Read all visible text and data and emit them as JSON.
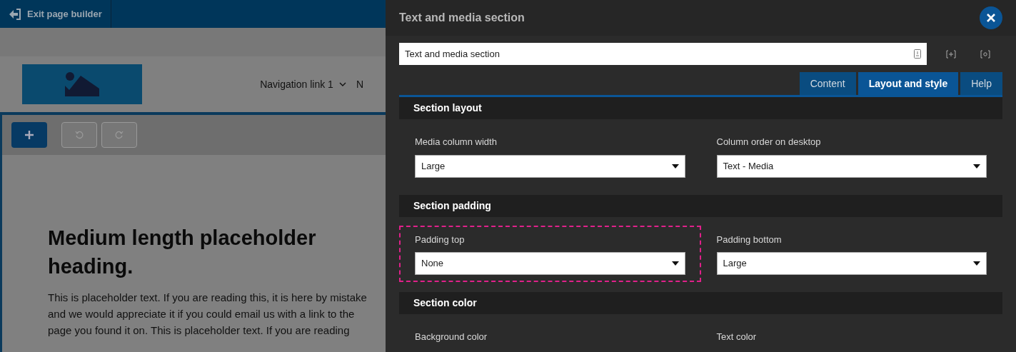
{
  "top_bar": {
    "exit_button": "Exit page builder"
  },
  "site_header": {
    "nav_link": "Navigation link 1",
    "nav_link_cut": "N"
  },
  "content": {
    "heading": "Medium length placeholder heading.",
    "paragraph": "This is placeholder text. If you are reading this, it is here by mistake and we would appreciate it if you could email us with a link to the page you found it on. This is placeholder text. If you are reading"
  },
  "panel": {
    "title": "Text and media section",
    "name_field": {
      "value": "Text and media section"
    },
    "tabs": [
      {
        "label": "Content",
        "selected": false
      },
      {
        "label": "Layout and style",
        "selected": true
      },
      {
        "label": "Help",
        "selected": false
      }
    ],
    "sections": [
      {
        "title": "Section layout",
        "fields": [
          {
            "label": "Media column width",
            "value": "Large",
            "highlighted": false
          },
          {
            "label": "Column order on desktop",
            "value": "Text - Media",
            "highlighted": false
          }
        ]
      },
      {
        "title": "Section padding",
        "fields": [
          {
            "label": "Padding top",
            "value": "None",
            "highlighted": true
          },
          {
            "label": "Padding bottom",
            "value": "Large",
            "highlighted": false
          }
        ]
      },
      {
        "title": "Section color",
        "fields": [
          {
            "label": "Background color",
            "highlighted": false
          },
          {
            "label": "Text color",
            "highlighted": false
          }
        ]
      }
    ]
  }
}
